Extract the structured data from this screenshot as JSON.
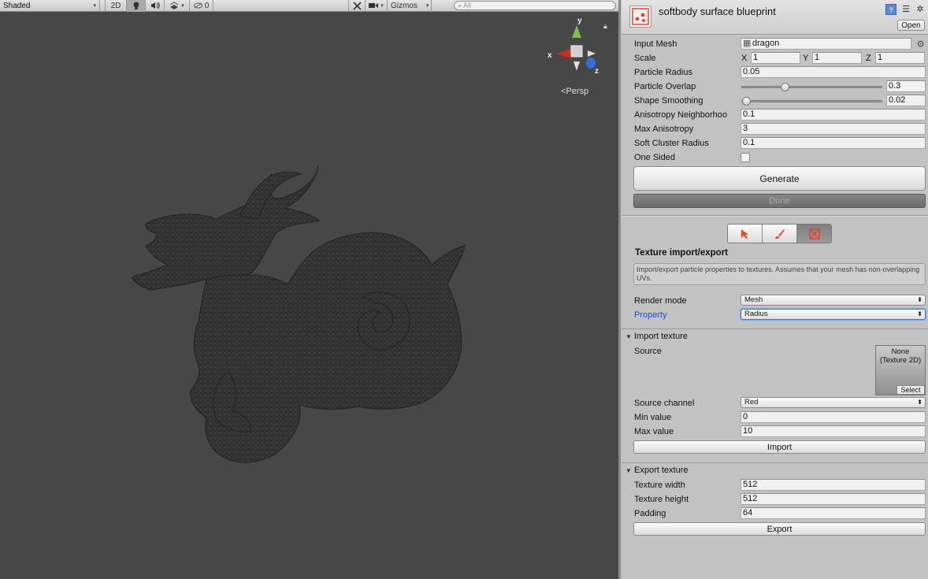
{
  "scene_toolbar": {
    "shading_mode": "Shaded",
    "mode_2d": "2D",
    "hidden_count": "0",
    "gizmos_label": "Gizmos",
    "search_placeholder": "All"
  },
  "scene": {
    "persp_label": "Persp",
    "axis_x": "x",
    "axis_y": "y",
    "axis_z": "z"
  },
  "inspector": {
    "title": "softbody surface blueprint",
    "open_label": "Open",
    "fields": {
      "input_mesh_label": "Input Mesh",
      "input_mesh_value": "dragon",
      "scale_label": "Scale",
      "scale_x_label": "X",
      "scale_x": "1",
      "scale_y_label": "Y",
      "scale_y": "1",
      "scale_z_label": "Z",
      "scale_z": "1",
      "particle_radius_label": "Particle Radius",
      "particle_radius": "0.05",
      "particle_overlap_label": "Particle Overlap",
      "particle_overlap": "0.3",
      "particle_overlap_fraction": 0.3,
      "shape_smoothing_label": "Shape Smoothing",
      "shape_smoothing": "0.02",
      "shape_smoothing_fraction": 0.0,
      "anisotropy_neighborhood_label": "Anisotropy Neighborhoo",
      "anisotropy_neighborhood": "0.1",
      "max_anisotropy_label": "Max Anisotropy",
      "max_anisotropy": "3",
      "soft_cluster_radius_label": "Soft Cluster Radius",
      "soft_cluster_radius": "0.1",
      "one_sided_label": "One Sided",
      "one_sided_checked": false
    },
    "generate_label": "Generate",
    "done_label": "Done",
    "section_title": "Texture import/export",
    "help_text": "Import/export particle properties to textures. Assumes that your mesh has non-overlapping UVs.",
    "render_mode_label": "Render mode",
    "render_mode_value": "Mesh",
    "property_label": "Property",
    "property_value": "Radius",
    "import": {
      "title": "Import texture",
      "source_label": "Source",
      "source_value": "None\n(Texture 2D)",
      "select_label": "Select",
      "source_channel_label": "Source channel",
      "source_channel_value": "Red",
      "min_value_label": "Min value",
      "min_value": "0",
      "max_value_label": "Max value",
      "max_value": "10",
      "button_label": "Import"
    },
    "export": {
      "title": "Export texture",
      "width_label": "Texture width",
      "width_value": "512",
      "height_label": "Texture height",
      "height_value": "512",
      "padding_label": "Padding",
      "padding_value": "64",
      "button_label": "Export"
    }
  },
  "colors": {
    "scene_bg": "#474747",
    "inspector_bg": "#c2c2c2",
    "accent_red": "#e8442a",
    "property_blue": "#1f4fd8"
  }
}
